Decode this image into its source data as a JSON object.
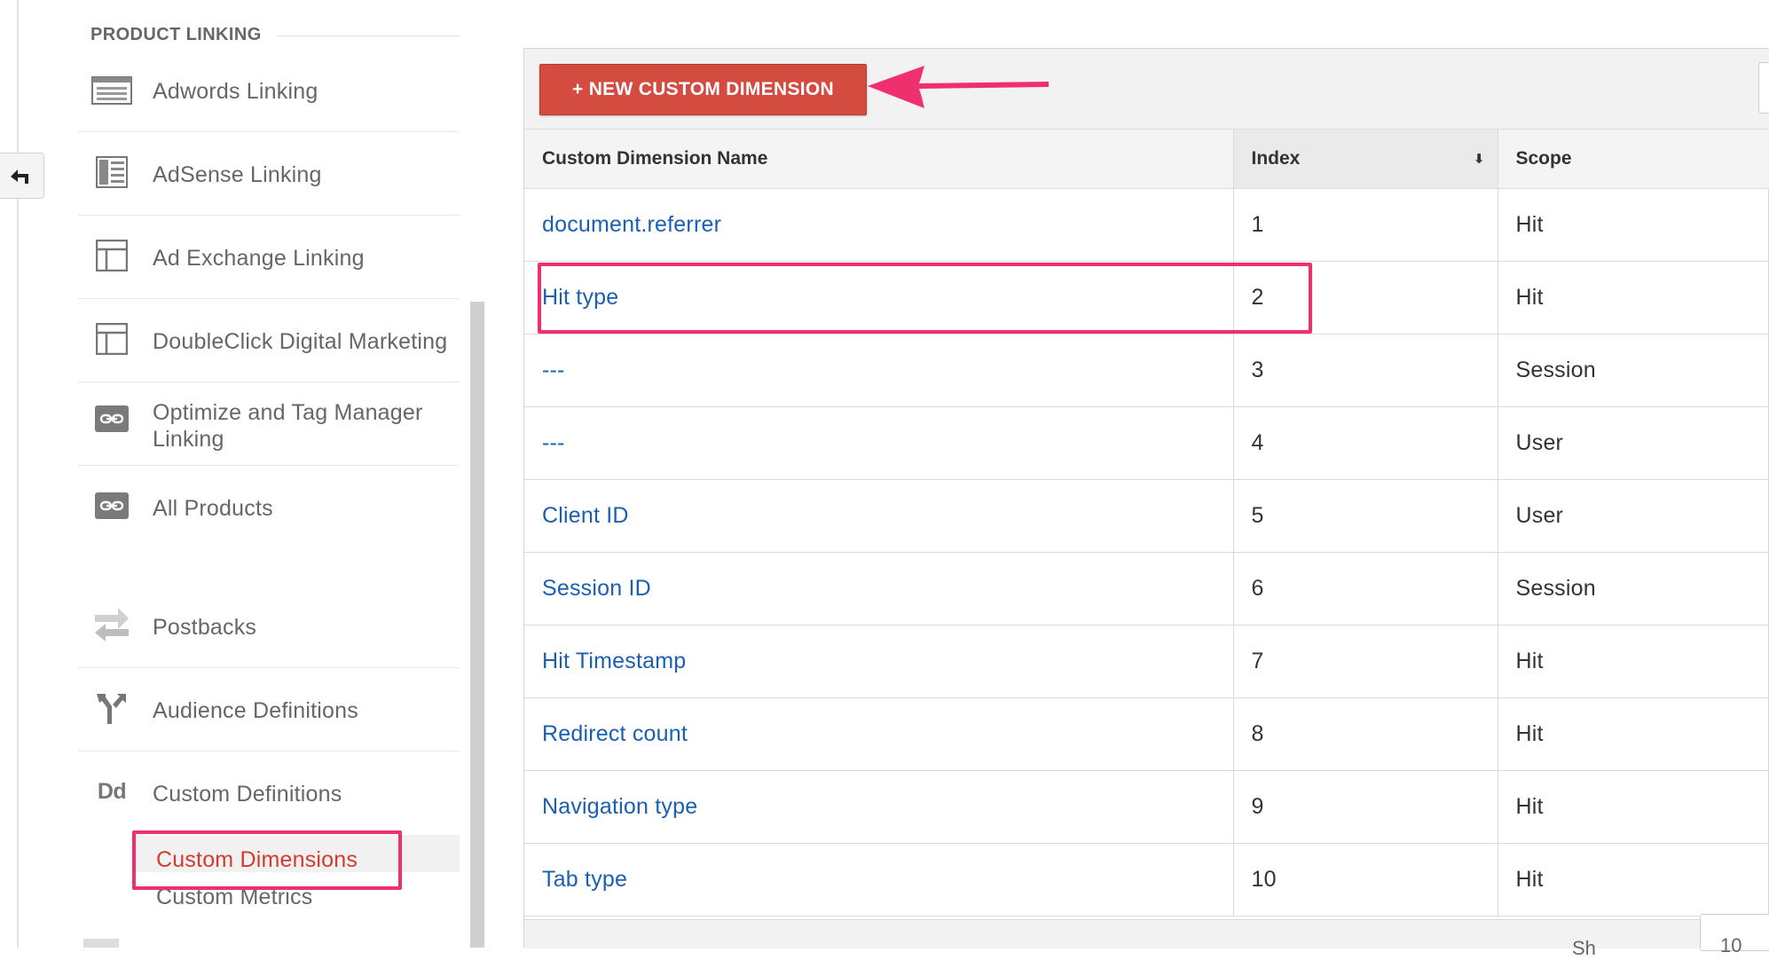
{
  "sidebar": {
    "section_title": "PRODUCT LINKING",
    "items": [
      {
        "label": "Adwords Linking",
        "icon": "adwords-icon"
      },
      {
        "label": "AdSense Linking",
        "icon": "adsense-icon"
      },
      {
        "label": "Ad Exchange Linking",
        "icon": "ad-exchange-icon"
      },
      {
        "label": "DoubleClick Digital Marketing",
        "icon": "doubleclick-icon"
      },
      {
        "label": "Optimize and Tag Manager Linking",
        "icon": "link-icon"
      },
      {
        "label": "All Products",
        "icon": "link-icon"
      },
      {
        "label": "Postbacks",
        "icon": "postbacks-icon"
      },
      {
        "label": "Audience Definitions",
        "icon": "audience-fork-icon"
      },
      {
        "label": "Custom Definitions",
        "icon": "dd-icon"
      }
    ],
    "sub_items": [
      {
        "label": "Custom Dimensions",
        "active": true
      },
      {
        "label": "Custom Metrics",
        "active": false
      }
    ]
  },
  "toolbar": {
    "new_button_label": "+ NEW CUSTOM DIMENSION"
  },
  "table": {
    "columns": [
      "Custom Dimension Name",
      "Index",
      "Scope"
    ],
    "sorted_column": "Index",
    "rows": [
      {
        "name": "document.referrer",
        "index": "1",
        "scope": "Hit"
      },
      {
        "name": "Hit type",
        "index": "2",
        "scope": "Hit"
      },
      {
        "name": "---",
        "index": "3",
        "scope": "Session"
      },
      {
        "name": "---",
        "index": "4",
        "scope": "User"
      },
      {
        "name": "Client ID",
        "index": "5",
        "scope": "User"
      },
      {
        "name": "Session ID",
        "index": "6",
        "scope": "Session"
      },
      {
        "name": "Hit Timestamp",
        "index": "7",
        "scope": "Hit"
      },
      {
        "name": "Redirect count",
        "index": "8",
        "scope": "Hit"
      },
      {
        "name": "Navigation type",
        "index": "9",
        "scope": "Hit"
      },
      {
        "name": "Tab type",
        "index": "10",
        "scope": "Hit"
      }
    ]
  },
  "footer": {
    "show_rows_text": "Sh",
    "rows_value": "10"
  },
  "colors": {
    "accent_red": "#d44b3f",
    "highlight_pink": "#f0306e",
    "link_blue": "#1a5fb4",
    "active_sub_red": "#d33b2c"
  }
}
